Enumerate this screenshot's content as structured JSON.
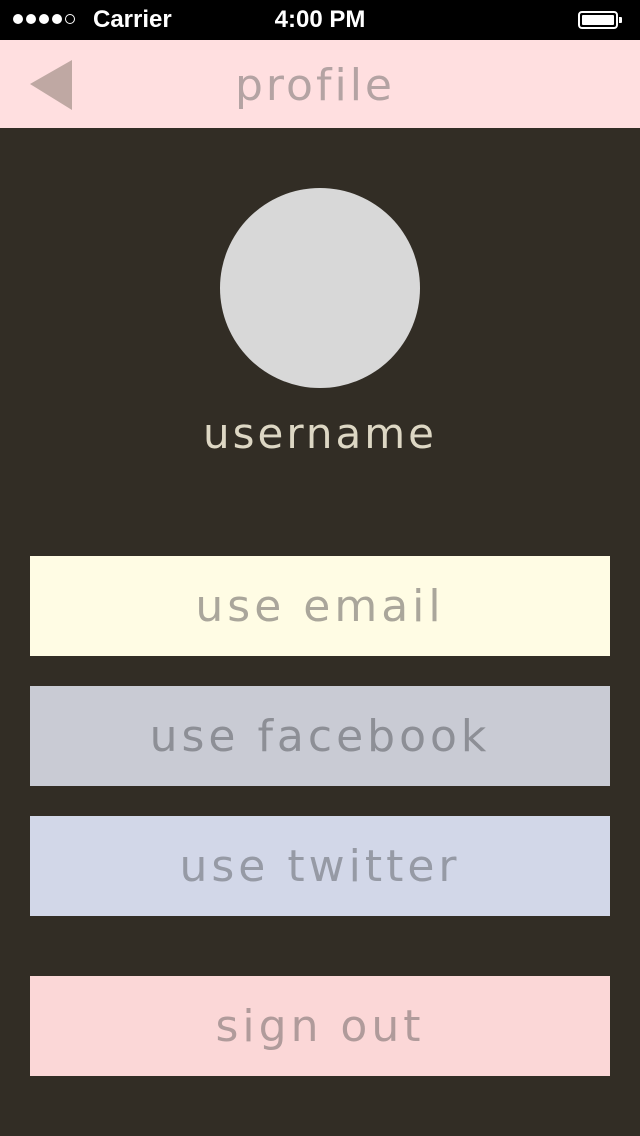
{
  "status_bar": {
    "carrier": "Carrier",
    "time": "4:00 PM",
    "signal_bars_filled": 4,
    "signal_bars_total": 5
  },
  "nav": {
    "title": "profile",
    "back_icon": "back-triangle-icon"
  },
  "profile": {
    "username": "username"
  },
  "actions": {
    "email_label": "use email",
    "facebook_label": "use facebook",
    "twitter_label": "use twitter",
    "signout_label": "sign out"
  },
  "colors": {
    "background": "#322d25",
    "nav_background": "#ffdfe0",
    "nav_text": "#b4a3a3",
    "avatar": "#d8d8d8",
    "username_text": "#ddd7c4",
    "email_button": "#fffce4",
    "facebook_button": "#c9cbd4",
    "twitter_button": "#d2d7e8",
    "signout_button": "#fbd7d7"
  }
}
